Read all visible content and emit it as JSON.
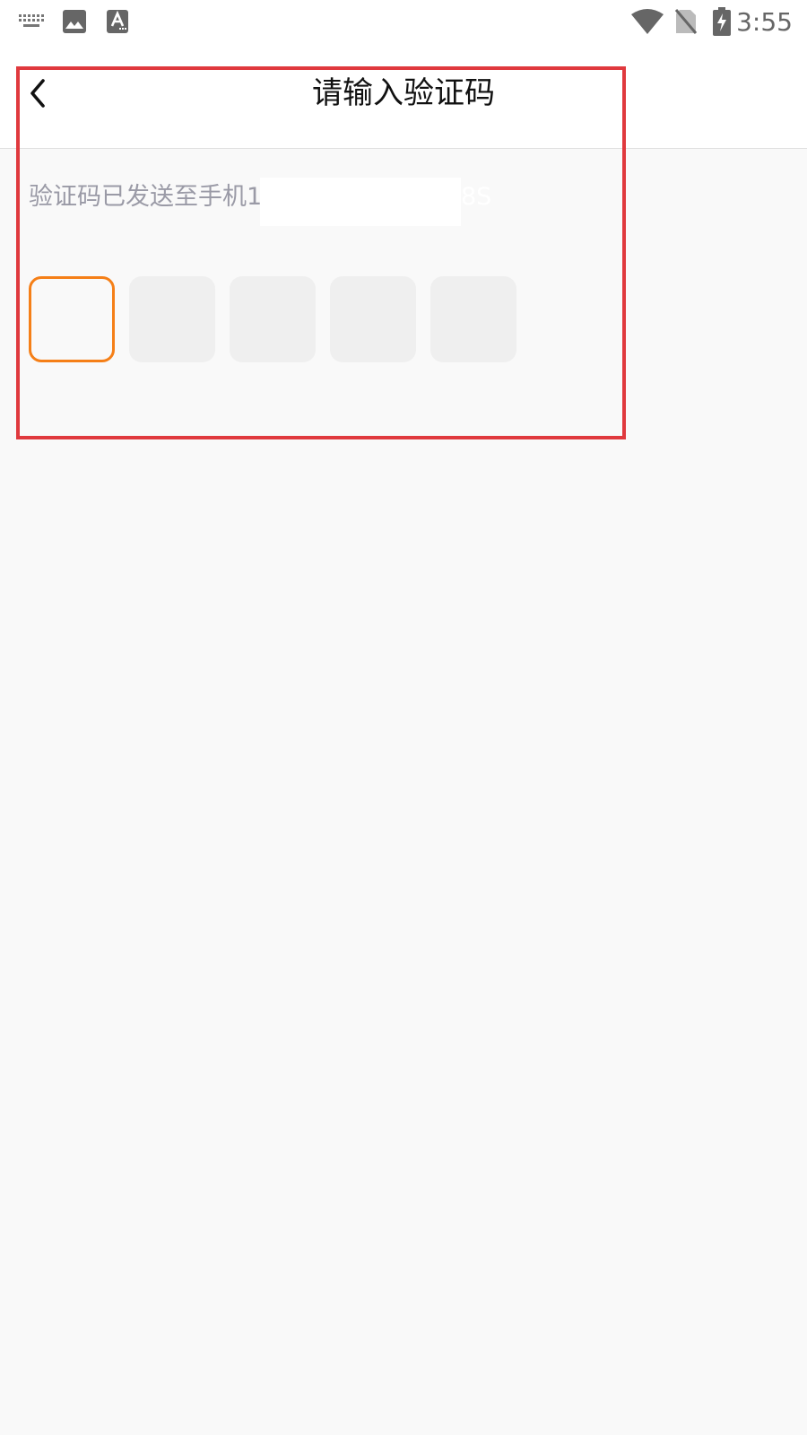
{
  "status_bar": {
    "time": "3:55",
    "icons": [
      "keyboard-icon",
      "image-icon",
      "text-a-icon",
      "wifi-icon",
      "no-sim-icon",
      "battery-charging-icon"
    ]
  },
  "header": {
    "title": "请输入验证码",
    "back_icon": "chevron-left-icon"
  },
  "hint": {
    "text": "验证码已发送至手机1",
    "countdown": "8S"
  },
  "code_boxes": [
    {
      "value": "",
      "state": "focused"
    },
    {
      "value": "",
      "state": "empty"
    },
    {
      "value": "",
      "state": "empty"
    },
    {
      "value": "",
      "state": "empty"
    },
    {
      "value": "",
      "state": "empty"
    }
  ],
  "colors": {
    "accent": "#f57f17",
    "highlight": "#e0393e",
    "hint_text": "#9a9aa6",
    "box_fill": "#efefef",
    "background": "#f9f9f9"
  }
}
